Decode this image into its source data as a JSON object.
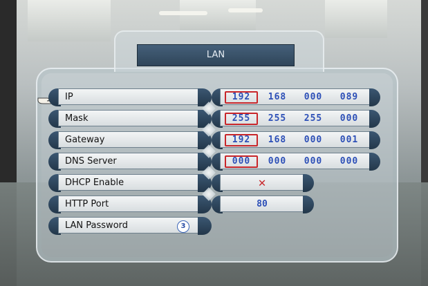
{
  "title": "LAN",
  "menu": [
    {
      "label": "IP",
      "selected": true
    },
    {
      "label": "Mask"
    },
    {
      "label": "Gateway"
    },
    {
      "label": "DNS Server"
    },
    {
      "label": "DHCP Enable"
    },
    {
      "label": "HTTP Port"
    },
    {
      "label": "LAN Password",
      "badge": "3"
    }
  ],
  "values": {
    "ip": [
      "192",
      "168",
      "000",
      "089"
    ],
    "mask": [
      "255",
      "255",
      "255",
      "000"
    ],
    "gateway": [
      "192",
      "168",
      "000",
      "001"
    ],
    "dns": [
      "000",
      "000",
      "000",
      "000"
    ],
    "dhcp_enable": "✕",
    "http_port": "80"
  },
  "colors": {
    "accent_blue": "#2c4fb7",
    "selection_red": "#c8262a",
    "title_bg": "#3b5772"
  },
  "icons": {
    "pointer": "pointing-hand-icon",
    "badge": "password-digit-badge"
  }
}
